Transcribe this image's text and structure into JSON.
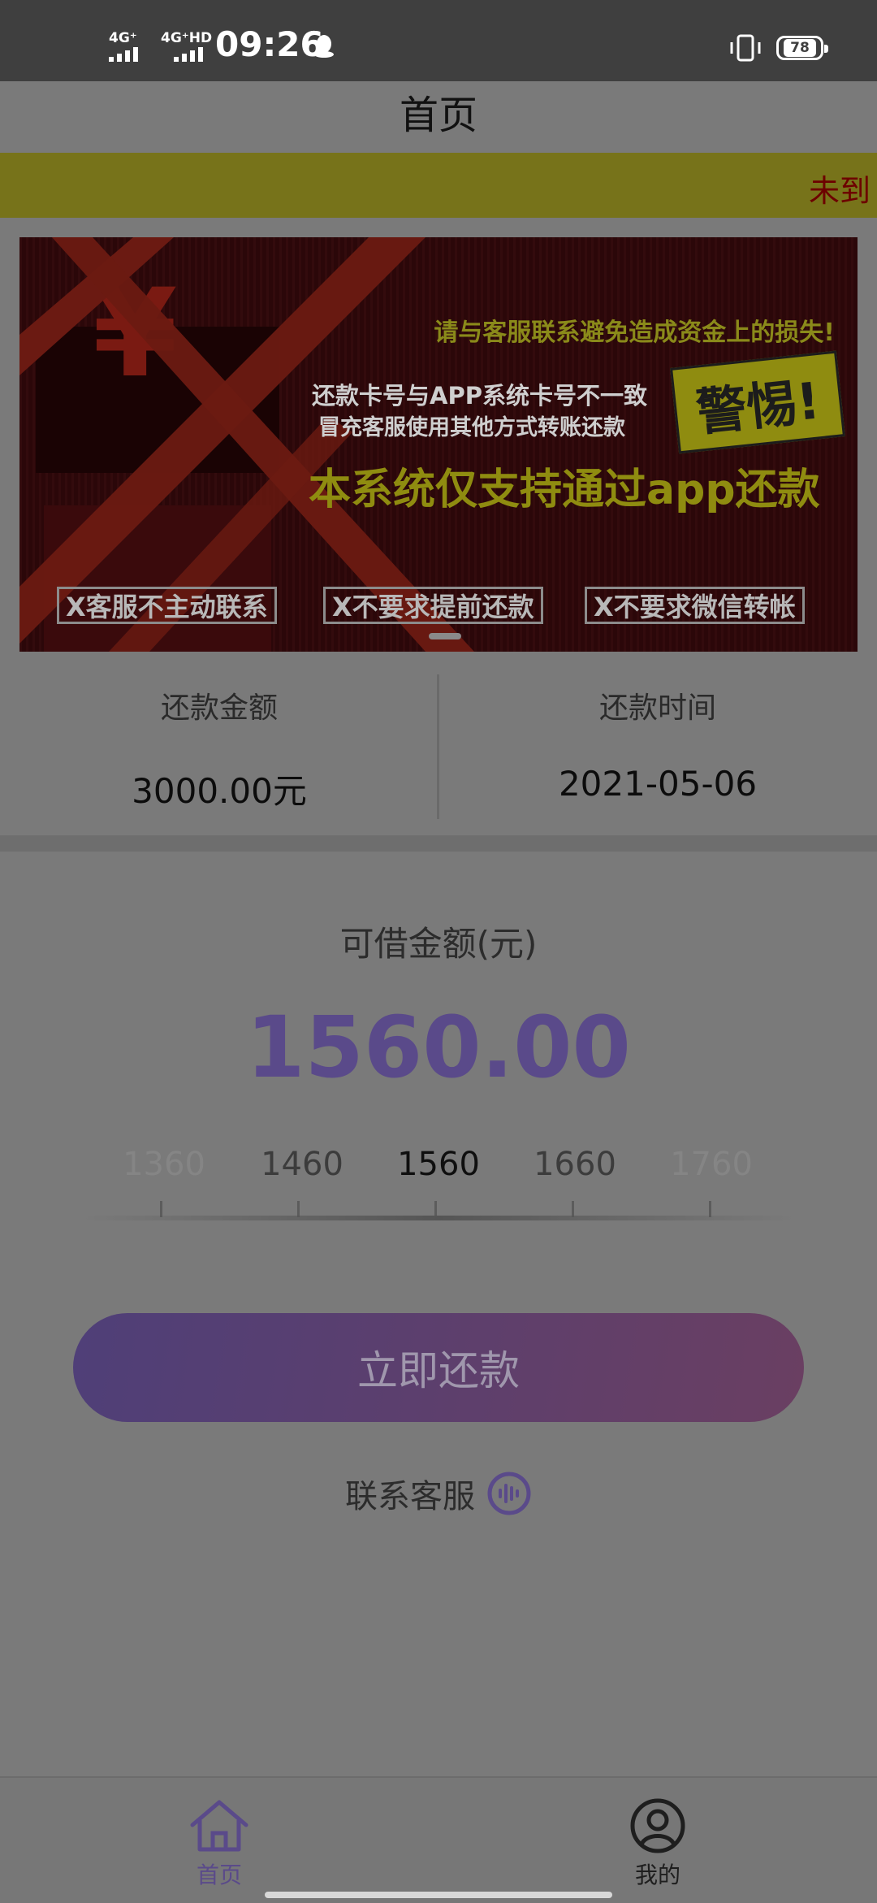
{
  "status_bar": {
    "network1": "4G⁺",
    "network2": "4G⁺HD",
    "time": "09:26",
    "battery": "78"
  },
  "header": {
    "title": "首页"
  },
  "marquee": {
    "text": "未到"
  },
  "banner": {
    "line1": "请与客服联系避免造成资金上的损失!",
    "line2": "还款卡号与APP系统卡号不一致",
    "line3": "冒充客服使用其他方式转账还款",
    "badge": "警惕!",
    "line4": "本系统仅支持通过app还款",
    "chips": [
      "X客服不主动联系",
      "X不要求提前还款",
      "X不要求微信转帐"
    ]
  },
  "repayment_info": {
    "amount_label": "还款金额",
    "amount_value": "3000.00元",
    "date_label": "还款时间",
    "date_value": "2021-05-06"
  },
  "loan": {
    "available_label": "可借金额(元)",
    "available_amount": "1560.00",
    "scale": [
      "1360",
      "1460",
      "1560",
      "1660",
      "1760"
    ],
    "scale_selected": "1560"
  },
  "actions": {
    "repay_button": "立即还款",
    "service_label": "联系客服"
  },
  "tabbar": {
    "home": "首页",
    "mine": "我的"
  },
  "colors": {
    "accent": "#5a4a8a",
    "button_gradient_start": "#4f3f78",
    "button_gradient_end": "#6a3f62",
    "marquee_bg": "#77731a"
  }
}
